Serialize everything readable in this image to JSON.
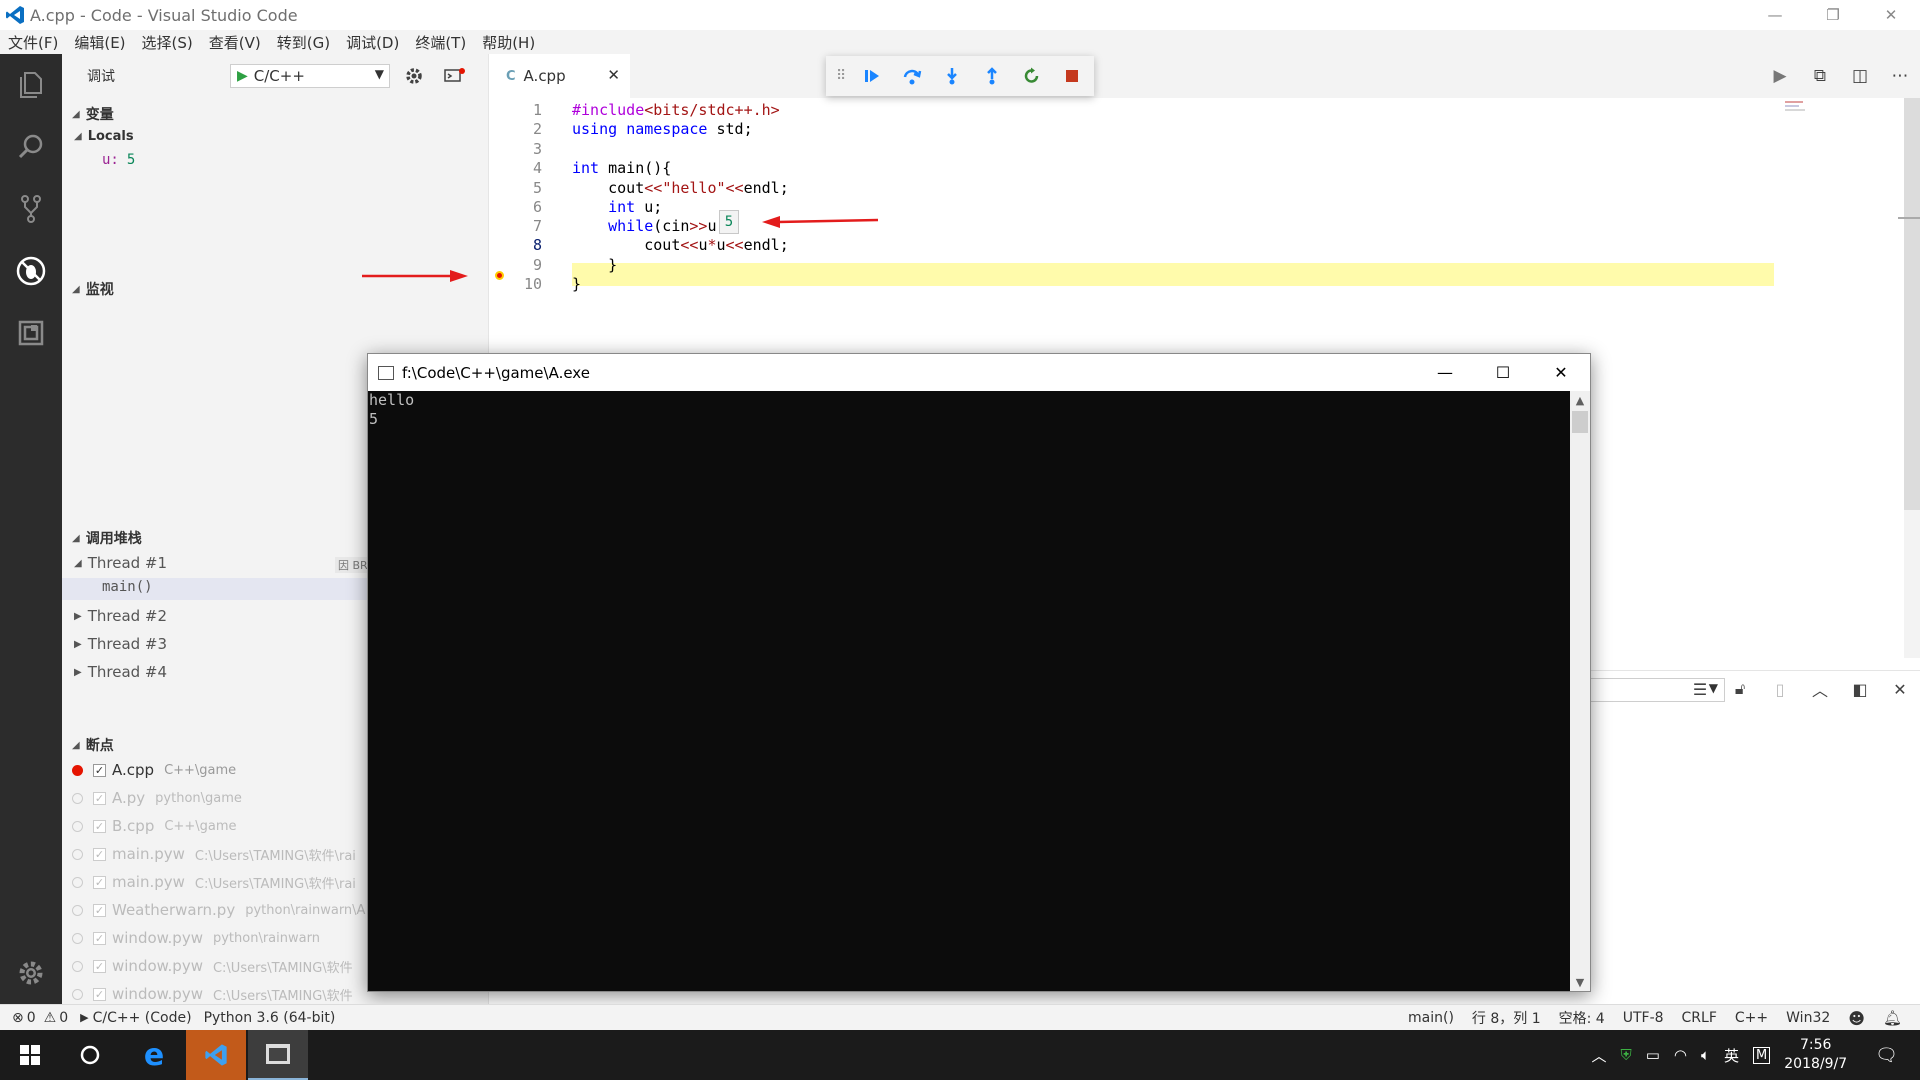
{
  "window": {
    "title": "A.cpp - Code - Visual Studio Code",
    "controls": [
      "—",
      "❐",
      "✕"
    ]
  },
  "menu": [
    "文件(F)",
    "编辑(E)",
    "选择(S)",
    "查看(V)",
    "转到(G)",
    "调试(D)",
    "终端(T)",
    "帮助(H)"
  ],
  "sidebar": {
    "debug_title": "调试",
    "config_value": "C/C++",
    "variables_header": "变量",
    "locals_header": "Locals",
    "local_var": {
      "name": "u:",
      "value": "5"
    },
    "watch_header": "监视",
    "callstack_header": "调用堆栈",
    "threads": [
      {
        "label": "Thread #1",
        "expanded": true
      },
      {
        "label": "Thread #2",
        "expanded": false
      },
      {
        "label": "Thread #3",
        "expanded": false
      },
      {
        "label": "Thread #4",
        "expanded": false
      }
    ],
    "frame": "main()",
    "paused_badge": "因 BR",
    "breakpoints_header": "断点",
    "breakpoints": [
      {
        "file": "A.cpp",
        "path": "C++\\game",
        "enabled": true
      },
      {
        "file": "A.py",
        "path": "python\\game",
        "enabled": false
      },
      {
        "file": "B.cpp",
        "path": "C++\\game",
        "enabled": false
      },
      {
        "file": "main.pyw",
        "path": "C:\\Users\\TAMING\\软件\\rai",
        "enabled": false
      },
      {
        "file": "main.pyw",
        "path": "C:\\Users\\TAMING\\软件\\rai",
        "enabled": false
      },
      {
        "file": "Weatherwarn.py",
        "path": "python\\rainwarn\\A",
        "enabled": false
      },
      {
        "file": "window.pyw",
        "path": "python\\rainwarn",
        "enabled": false
      },
      {
        "file": "window.pyw",
        "path": "C:\\Users\\TAMING\\软件",
        "enabled": false
      },
      {
        "file": "window.pyw",
        "path": "C:\\Users\\TAMING\\软件",
        "enabled": false
      }
    ]
  },
  "editor": {
    "tab_label": "A.cpp",
    "hover_value": "5",
    "current_line": "8",
    "lines": [
      {
        "no": "1",
        "html": "<span class='pp'>#include</span><span class='str'>&lt;bits/stdc++.h&gt;</span>"
      },
      {
        "no": "2",
        "html": "<span class='kw'>using</span> <span class='kw'>namespace</span> <span class='plain'>std;</span>"
      },
      {
        "no": "3",
        "html": ""
      },
      {
        "no": "4",
        "html": "<span class='kw'>int</span> <span class='plain'>main(){</span>"
      },
      {
        "no": "5",
        "html": "    <span class='plain'>cout</span><span class='op'>&lt;&lt;</span><span class='str'>\"hello\"</span><span class='op'>&lt;&lt;</span><span class='plain'>endl;</span>"
      },
      {
        "no": "6",
        "html": "    <span class='kw'>int</span> <span class='plain'>u;</span>"
      },
      {
        "no": "7",
        "html": "    <span class='kw'>while</span><span class='plain'>(cin</span><span class='op'>&gt;&gt;</span><span class='plain'>u){</span>"
      },
      {
        "no": "8",
        "html": "        <span class='plain'>cout</span><span class='op'>&lt;&lt;</span><span class='plain'>u</span><span class='op'>*</span><span class='plain'>u</span><span class='op'>&lt;&lt;</span><span class='plain'>endl;</span>"
      },
      {
        "no": "9",
        "html": "    <span class='plain'>}</span>"
      },
      {
        "no": "10",
        "html": "<span class='plain'>}</span>"
      }
    ]
  },
  "console": {
    "title": "f:\\Code\\C++\\game\\A.exe",
    "output": [
      "hello",
      "5"
    ]
  },
  "statusbar": {
    "errors": "0",
    "warnings": "0",
    "debug_target": "C/C++ (Code)",
    "interpreter": "Python 3.6 (64-bit)",
    "scope": "main()",
    "position": "行 8，列 1",
    "indent": "空格: 4",
    "encoding": "UTF-8",
    "eol": "CRLF",
    "language": "C++",
    "platform": "Win32"
  },
  "taskbar": {
    "ime": "英",
    "ime2": "M",
    "time": "7:56",
    "date": "2018/9/7"
  },
  "colors": {
    "activitybar": "#2c2c2c",
    "highlight_line": "#fffbab",
    "breakpoint": "#e51400",
    "arrow": "#e31c1c"
  }
}
